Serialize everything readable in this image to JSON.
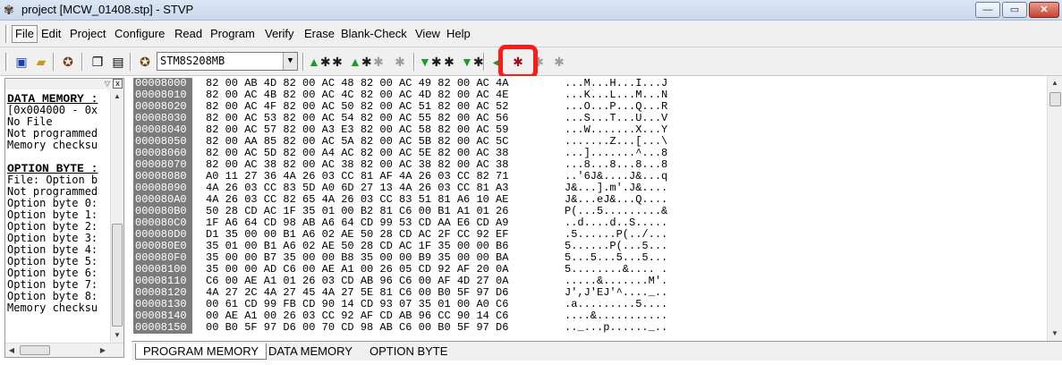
{
  "window": {
    "title": "project [MCW_01408.stp] - STVP",
    "app_icon": "stvp-app-icon",
    "controls": {
      "minimize": "—",
      "maximize": "▭",
      "close": "✕"
    }
  },
  "menu": {
    "items": [
      "File",
      "Edit",
      "Project",
      "Configure",
      "Read",
      "Program",
      "Verify",
      "Erase",
      "Blank-Check",
      "View",
      "Help"
    ]
  },
  "toolbar": {
    "device": "STM8S208MB",
    "icons": [
      "save-icon",
      "open-icon",
      "project-icon",
      "copy-icon",
      "paste-icon",
      "device-chip-icon",
      "read-all-icon",
      "read-current-icon",
      "read-option-icon",
      "read-disabled-icon",
      "read-disabled-icon",
      "program-all-icon",
      "program-current-icon",
      "program-option-icon",
      "verify-all-icon",
      "verify-current-icon",
      "verify-disabled-icon",
      "verify-disabled-icon"
    ],
    "highlight_color": "#ff1a1a"
  },
  "left_panel": {
    "lines": [
      {
        "text": "DATA MEMORY :",
        "style": "heading"
      },
      {
        "text": "[0x004000 - 0x",
        "style": "normal"
      },
      {
        "text": "No File",
        "style": "normal"
      },
      {
        "text": "Not programmed",
        "style": "normal"
      },
      {
        "text": "Memory checksu",
        "style": "normal"
      },
      {
        "text": "",
        "style": "normal"
      },
      {
        "text": "OPTION BYTE :",
        "style": "heading"
      },
      {
        "text": "File: Option b",
        "style": "normal"
      },
      {
        "text": "Not programmed",
        "style": "normal"
      },
      {
        "text": "Option byte 0:",
        "style": "normal"
      },
      {
        "text": "Option byte 1:",
        "style": "normal"
      },
      {
        "text": "Option byte 2:",
        "style": "normal"
      },
      {
        "text": "Option byte 3:",
        "style": "normal"
      },
      {
        "text": "Option byte 4:",
        "style": "normal"
      },
      {
        "text": "Option byte 5:",
        "style": "normal"
      },
      {
        "text": "Option byte 6:",
        "style": "normal"
      },
      {
        "text": "Option byte 7:",
        "style": "normal"
      },
      {
        "text": "Option byte 8:",
        "style": "normal"
      },
      {
        "text": "Memory checksu",
        "style": "normal"
      }
    ]
  },
  "hex": {
    "rows": [
      {
        "addr": "00008000",
        "bytes": "82 00 AB 4D 82 00 AC 48 82 00 AC 49 82 00 AC 4A",
        "ascii": "...M...H...I...J"
      },
      {
        "addr": "00008010",
        "bytes": "82 00 AC 4B 82 00 AC 4C 82 00 AC 4D 82 00 AC 4E",
        "ascii": "...K...L...M...N"
      },
      {
        "addr": "00008020",
        "bytes": "82 00 AC 4F 82 00 AC 50 82 00 AC 51 82 00 AC 52",
        "ascii": "...O...P...Q...R"
      },
      {
        "addr": "00008030",
        "bytes": "82 00 AC 53 82 00 AC 54 82 00 AC 55 82 00 AC 56",
        "ascii": "...S...T...U...V"
      },
      {
        "addr": "00008040",
        "bytes": "82 00 AC 57 82 00 A3 E3 82 00 AC 58 82 00 AC 59",
        "ascii": "...W.......X...Y"
      },
      {
        "addr": "00008050",
        "bytes": "82 00 AA 85 82 00 AC 5A 82 00 AC 5B 82 00 AC 5C",
        "ascii": ".......Z...[...\\"
      },
      {
        "addr": "00008060",
        "bytes": "82 00 AC 5D 82 00 A4 AC 82 00 AC 5E 82 00 AC 38",
        "ascii": "...].......^...8"
      },
      {
        "addr": "00008070",
        "bytes": "82 00 AC 38 82 00 AC 38 82 00 AC 38 82 00 AC 38",
        "ascii": "...8...8...8...8"
      },
      {
        "addr": "00008080",
        "bytes": "A0 11 27 36 4A 26 03 CC 81 AF 4A 26 03 CC 82 71",
        "ascii": "..'6J&....J&...q"
      },
      {
        "addr": "00008090",
        "bytes": "4A 26 03 CC 83 5D A0 6D 27 13 4A 26 03 CC 81 A3",
        "ascii": "J&...].m'.J&...."
      },
      {
        "addr": "000080A0",
        "bytes": "4A 26 03 CC 82 65 4A 26 03 CC 83 51 81 A6 10 AE",
        "ascii": "J&...eJ&...Q...."
      },
      {
        "addr": "000080B0",
        "bytes": "50 28 CD AC 1F 35 01 00 B2 81 C6 00 B1 A1 01 26",
        "ascii": "P(...5.........&"
      },
      {
        "addr": "000080C0",
        "bytes": "1F A6 64 CD 98 AB A6 64 CD 99 53 CD AA E6 CD A9",
        "ascii": "..d....d..S....."
      },
      {
        "addr": "000080D0",
        "bytes": "D1 35 00 00 B1 A6 02 AE 50 28 CD AC 2F CC 92 EF",
        "ascii": ".5......P(../..."
      },
      {
        "addr": "000080E0",
        "bytes": "35 01 00 B1 A6 02 AE 50 28 CD AC 1F 35 00 00 B6",
        "ascii": "5......P(...5..."
      },
      {
        "addr": "000080F0",
        "bytes": "35 00 00 B7 35 00 00 B8 35 00 00 B9 35 00 00 BA",
        "ascii": "5...5...5...5..."
      },
      {
        "addr": "00008100",
        "bytes": "35 00 00 AD C6 00 AE A1 00 26 05 CD 92 AF 20 0A",
        "ascii": "5........&.... ."
      },
      {
        "addr": "00008110",
        "bytes": "C6 00 AE A1 01 26 03 CD AB 96 C6 00 AF 4D 27 0A",
        "ascii": ".....&.......M'."
      },
      {
        "addr": "00008120",
        "bytes": "4A 27 2C 4A 27 45 4A 27 5E 81 C6 00 B0 5F 97 D6",
        "ascii": "J',J'EJ'^...._.."
      },
      {
        "addr": "00008130",
        "bytes": "00 61 CD 99 FB CD 90 14 CD 93 07 35 01 00 A0 C6",
        "ascii": ".a.........5...."
      },
      {
        "addr": "00008140",
        "bytes": "00 AE A1 00 26 03 CC 92 AF CD AB 96 CC 90 14 C6",
        "ascii": "....&..........."
      },
      {
        "addr": "00008150",
        "bytes": "00 B0 5F 97 D6 00 70 CD 98 AB C6 00 B0 5F 97 D6",
        "ascii": ".._...p......_.."
      }
    ]
  },
  "tabs": [
    {
      "label": "PROGRAM MEMORY",
      "active": true
    },
    {
      "label": "DATA MEMORY",
      "active": false
    },
    {
      "label": "OPTION BYTE",
      "active": false
    }
  ]
}
